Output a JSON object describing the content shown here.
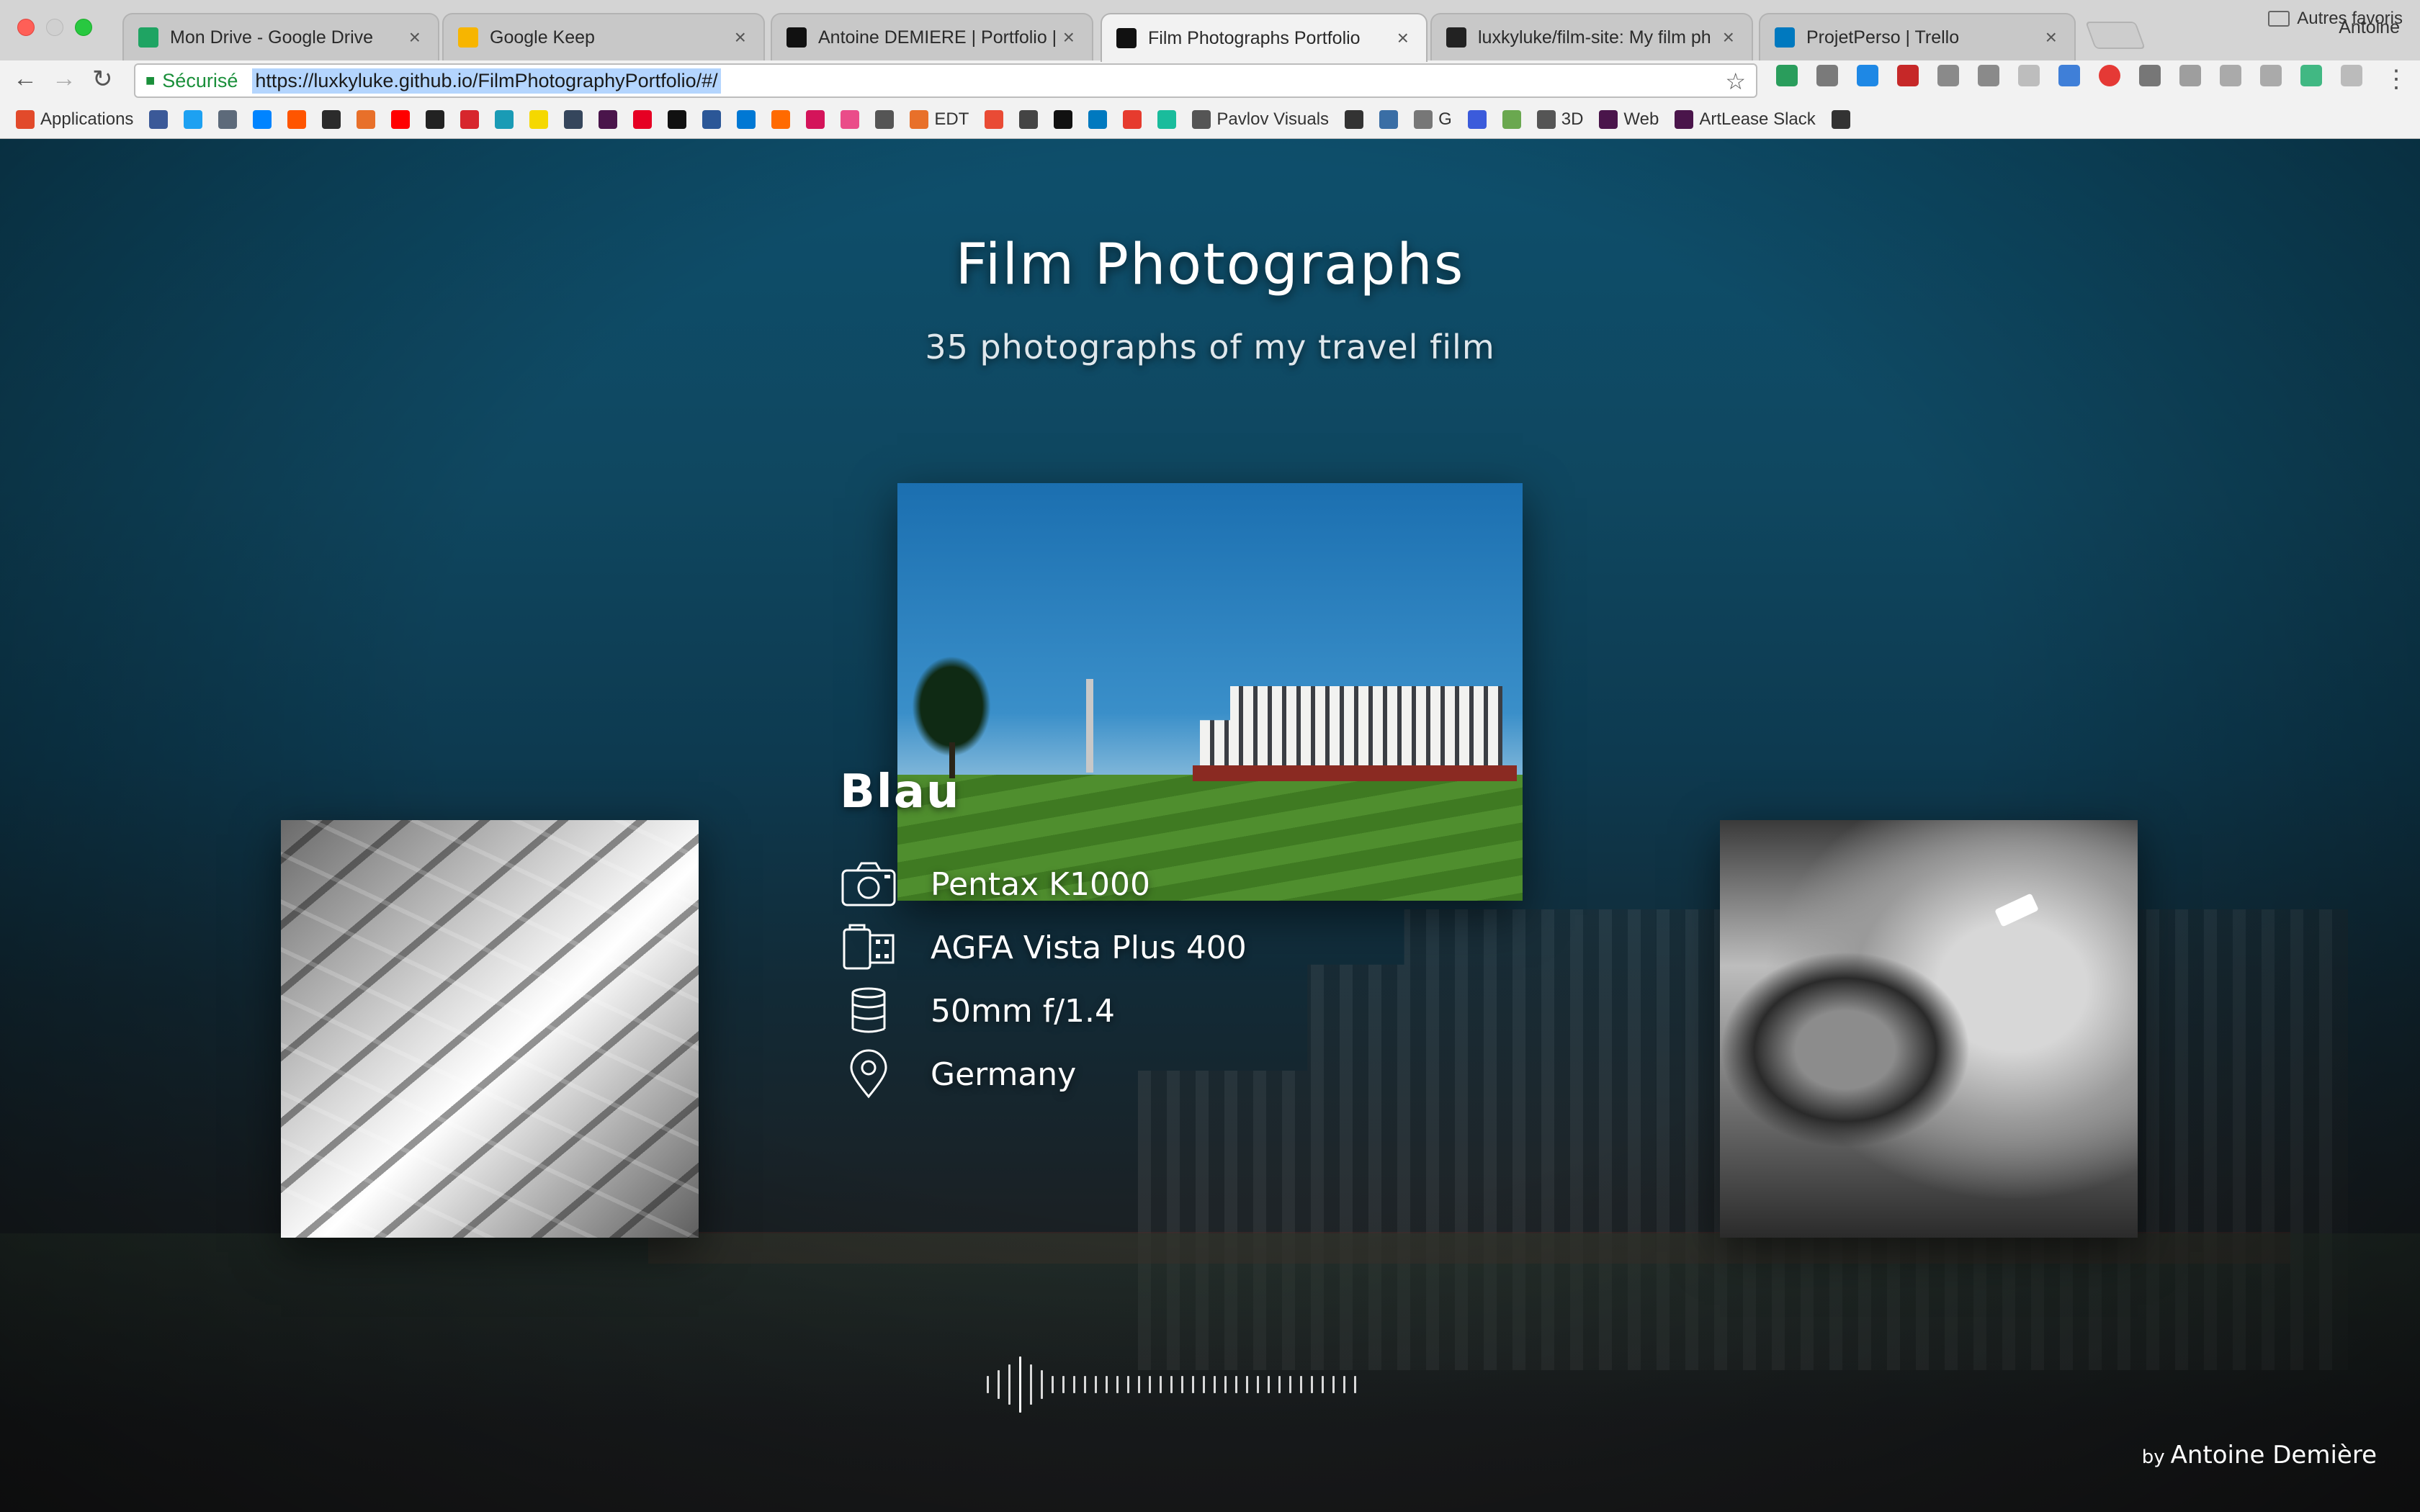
{
  "browser": {
    "profile": "Antoine",
    "tabs": [
      {
        "title": "Mon Drive - Google Drive",
        "color": "#1fa463"
      },
      {
        "title": "Google Keep",
        "color": "#f7b500"
      },
      {
        "title": "Antoine DEMIERE | Portfolio | (",
        "color": "#111111"
      },
      {
        "title": "Film Photographs Portfolio",
        "color": "#111111",
        "active": true
      },
      {
        "title": "luxkyluke/film-site: My film ph",
        "color": "#222222"
      },
      {
        "title": "ProjetPerso | Trello",
        "color": "#0079bf"
      }
    ],
    "secure_label": "Sécurisé",
    "url": "https://luxkyluke.github.io/FilmPhotographyPortfolio/#/",
    "bookmarks": [
      {
        "label": "Applications",
        "color": "#e24a2b"
      },
      {
        "label": "",
        "color": "#3b5998"
      },
      {
        "label": "",
        "color": "#1da1f2"
      },
      {
        "label": "",
        "color": "#5d6a7a"
      },
      {
        "label": "",
        "color": "#0084ff"
      },
      {
        "label": "",
        "color": "#ff5500"
      },
      {
        "label": "",
        "color": "#2b2b2b"
      },
      {
        "label": "",
        "color": "#e8702a"
      },
      {
        "label": "",
        "color": "#ff0000"
      },
      {
        "label": "",
        "color": "#222222"
      },
      {
        "label": "",
        "color": "#d7262d"
      },
      {
        "label": "",
        "color": "#1a9bb5"
      },
      {
        "label": "",
        "color": "#f5d800"
      },
      {
        "label": "",
        "color": "#35465c"
      },
      {
        "label": "",
        "color": "#4a154b"
      },
      {
        "label": "",
        "color": "#e60023"
      },
      {
        "label": "",
        "color": "#111111"
      },
      {
        "label": "",
        "color": "#2b5797"
      },
      {
        "label": "",
        "color": "#0078d4"
      },
      {
        "label": "",
        "color": "#ff6a00"
      },
      {
        "label": "",
        "color": "#d4145a"
      },
      {
        "label": "",
        "color": "#ea4c89"
      },
      {
        "label": "",
        "color": "#555555"
      },
      {
        "label": "EDT",
        "color": "#e8702a"
      },
      {
        "label": "",
        "color": "#e94b35"
      },
      {
        "label": "",
        "color": "#444444"
      },
      {
        "label": "",
        "color": "#111111"
      },
      {
        "label": "",
        "color": "#0079bf"
      },
      {
        "label": "",
        "color": "#e63b2e"
      },
      {
        "label": "",
        "color": "#1abc9c"
      },
      {
        "label": "Pavlov Visuals",
        "color": "#555555"
      },
      {
        "label": "",
        "color": "#333333"
      },
      {
        "label": "",
        "color": "#3a6ea5"
      },
      {
        "label": "G",
        "color": "#777777"
      },
      {
        "label": "",
        "color": "#3b5bdb"
      },
      {
        "label": "",
        "color": "#6aa84f"
      },
      {
        "label": "3D",
        "color": "#555555"
      },
      {
        "label": "Web",
        "color": "#4a154b"
      },
      {
        "label": "ArtLease Slack",
        "color": "#4a154b"
      },
      {
        "label": "",
        "color": "#333333"
      }
    ],
    "other_bookmarks": "Autres favoris"
  },
  "page": {
    "title": "Film Photographs",
    "subtitle": "35 photographs of my travel film",
    "photo": {
      "name": "Blau",
      "camera": "Pentax K1000",
      "film": "AGFA Vista Plus 400",
      "lens": "50mm f/1.4",
      "location": "Germany"
    },
    "scrubber": {
      "count": 35,
      "current": 3
    },
    "credit_by": "by",
    "credit_name": "Antoine Demière"
  },
  "colors": {
    "background_top": "#0e4f6c",
    "background_bottom": "#1c1d1e",
    "text": "#ffffff"
  }
}
